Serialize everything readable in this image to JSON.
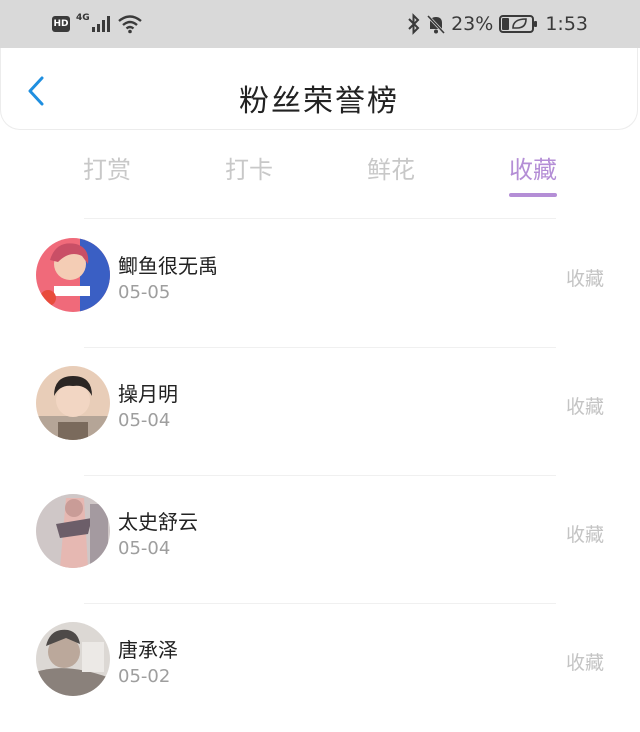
{
  "status_bar": {
    "hd_label": "HD",
    "network": "4G",
    "battery_percent": "23%",
    "time": "1:53"
  },
  "header": {
    "title": "粉丝荣誉榜"
  },
  "tabs": [
    {
      "label": "打赏",
      "active": false
    },
    {
      "label": "打卡",
      "active": false
    },
    {
      "label": "鲜花",
      "active": false
    },
    {
      "label": "收藏",
      "active": true
    }
  ],
  "fans": [
    {
      "name": "鲫鱼很无禹",
      "date": "05-05",
      "action": "收藏",
      "avatar_colors": [
        "#f06a7a",
        "#3a5fc4"
      ]
    },
    {
      "name": "操月明",
      "date": "05-04",
      "action": "收藏",
      "avatar_colors": [
        "#e8cdb8",
        "#7a6a5c"
      ]
    },
    {
      "name": "太史舒云",
      "date": "05-04",
      "action": "收藏",
      "avatar_colors": [
        "#cfc7c7",
        "#6c5e69"
      ]
    },
    {
      "name": "唐承泽",
      "date": "05-02",
      "action": "收藏",
      "avatar_colors": [
        "#dcd8d4",
        "#4e4a48"
      ]
    }
  ],
  "colors": {
    "accent": "#b48ed6",
    "back_arrow": "#1f8fe0",
    "status_bar_bg": "#d9d9d9"
  }
}
